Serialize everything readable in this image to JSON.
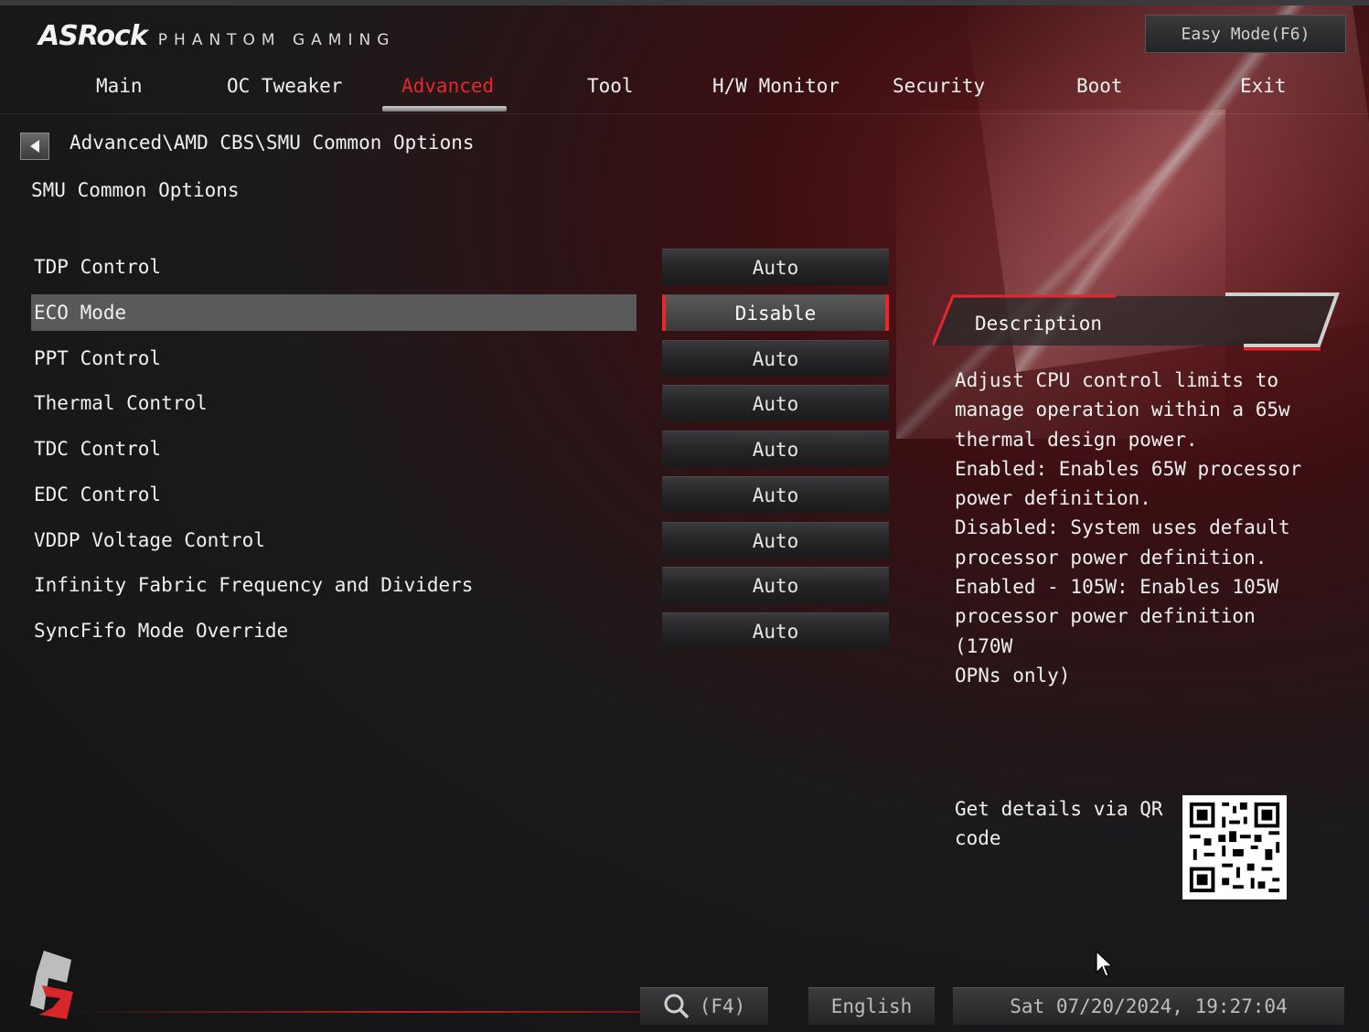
{
  "brand": {
    "name": "ASRock",
    "subtitle": "PHANTOM GAMING"
  },
  "easy_mode_label": "Easy Mode(F6)",
  "nav": {
    "items": [
      {
        "label": "Main",
        "active": false
      },
      {
        "label": "OC Tweaker",
        "active": false
      },
      {
        "label": "Advanced",
        "active": true
      },
      {
        "label": "Tool",
        "active": false
      },
      {
        "label": "H/W Monitor",
        "active": false
      },
      {
        "label": "Security",
        "active": false
      },
      {
        "label": "Boot",
        "active": false
      },
      {
        "label": "Exit",
        "active": false
      }
    ]
  },
  "breadcrumb": "Advanced\\AMD CBS\\SMU Common Options",
  "page_title": "SMU Common Options",
  "settings": [
    {
      "label": "TDP Control",
      "value": "Auto",
      "selected": false
    },
    {
      "label": "ECO Mode",
      "value": "Disable",
      "selected": true
    },
    {
      "label": "PPT Control",
      "value": "Auto",
      "selected": false
    },
    {
      "label": "Thermal Control",
      "value": "Auto",
      "selected": false
    },
    {
      "label": "TDC Control",
      "value": "Auto",
      "selected": false
    },
    {
      "label": "EDC Control",
      "value": "Auto",
      "selected": false
    },
    {
      "label": "VDDP Voltage Control",
      "value": "Auto",
      "selected": false
    },
    {
      "label": "Infinity Fabric Frequency and Dividers",
      "value": "Auto",
      "selected": false
    },
    {
      "label": "SyncFifo Mode Override",
      "value": "Auto",
      "selected": false
    }
  ],
  "description": {
    "title": "Description",
    "text": "Adjust CPU control limits to\nmanage operation within a 65w\nthermal design power.\nEnabled: Enables 65W processor\npower definition.\nDisabled: System uses default\nprocessor power definition.\nEnabled - 105W: Enables 105W\nprocessor power definition (170W\nOPNs only)"
  },
  "qr_label": "Get details via QR code",
  "footer": {
    "search_label": "(F4)",
    "language": "English",
    "datetime": "Sat 07/20/2024, 19:27:04"
  },
  "colors": {
    "accent": "#e8262b",
    "selected_row": "#595959"
  }
}
